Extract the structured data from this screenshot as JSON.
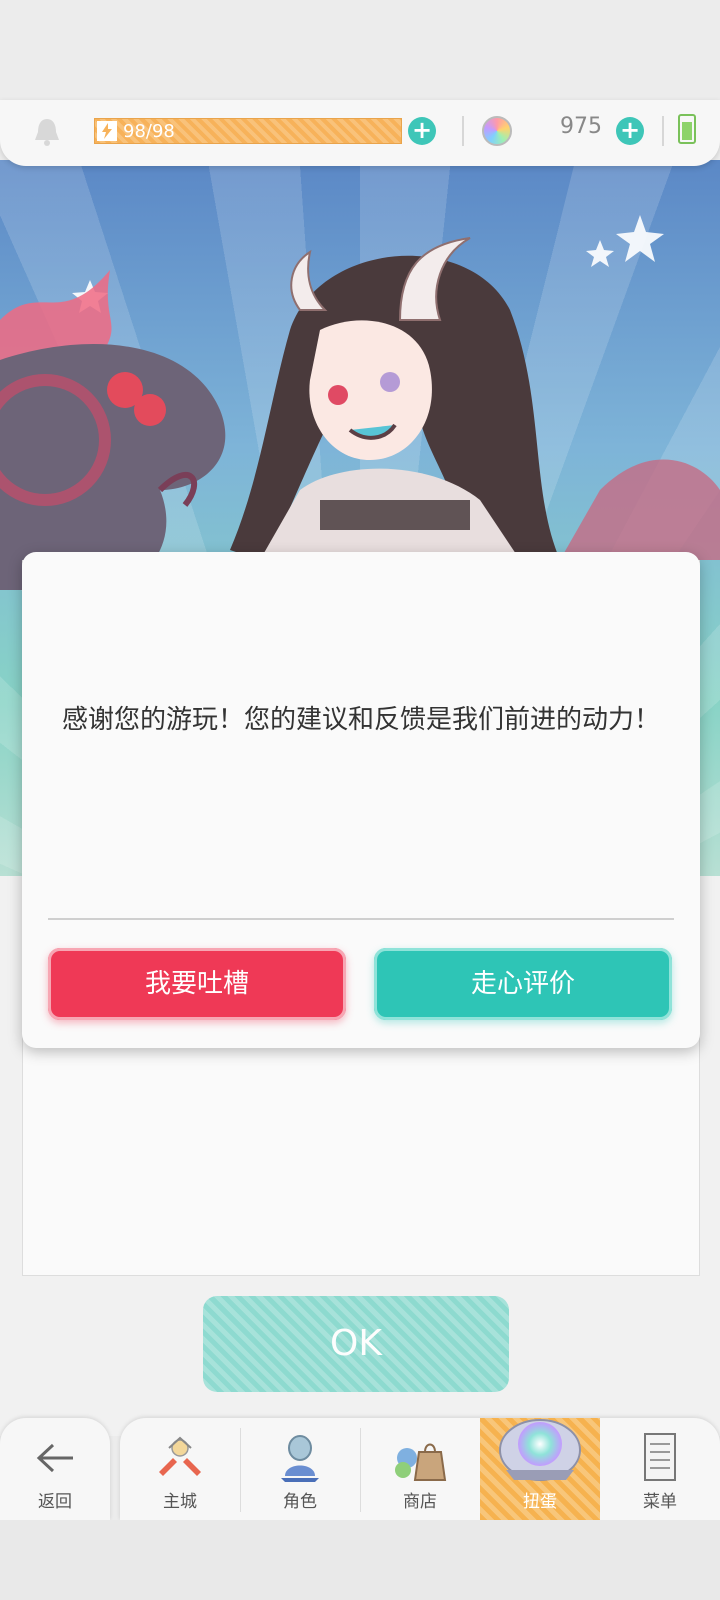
{
  "status_bar": {
    "energy_text": "98/98",
    "gems_count": "975"
  },
  "dialog": {
    "message": "感谢您的游玩！您的建议和反馈是我们前进的动力！",
    "complain_button": "我要吐槽",
    "review_button": "走心评价"
  },
  "ok_button": "OK",
  "nav": {
    "back": "返回",
    "items": [
      {
        "label": "主城"
      },
      {
        "label": "角色"
      },
      {
        "label": "商店"
      },
      {
        "label": "扭蛋"
      },
      {
        "label": "菜单"
      }
    ],
    "active_index": 3
  },
  "colors": {
    "accent_red": "#ef3956",
    "accent_teal": "#2ec5b6",
    "active_tab": "#f6b24f"
  }
}
